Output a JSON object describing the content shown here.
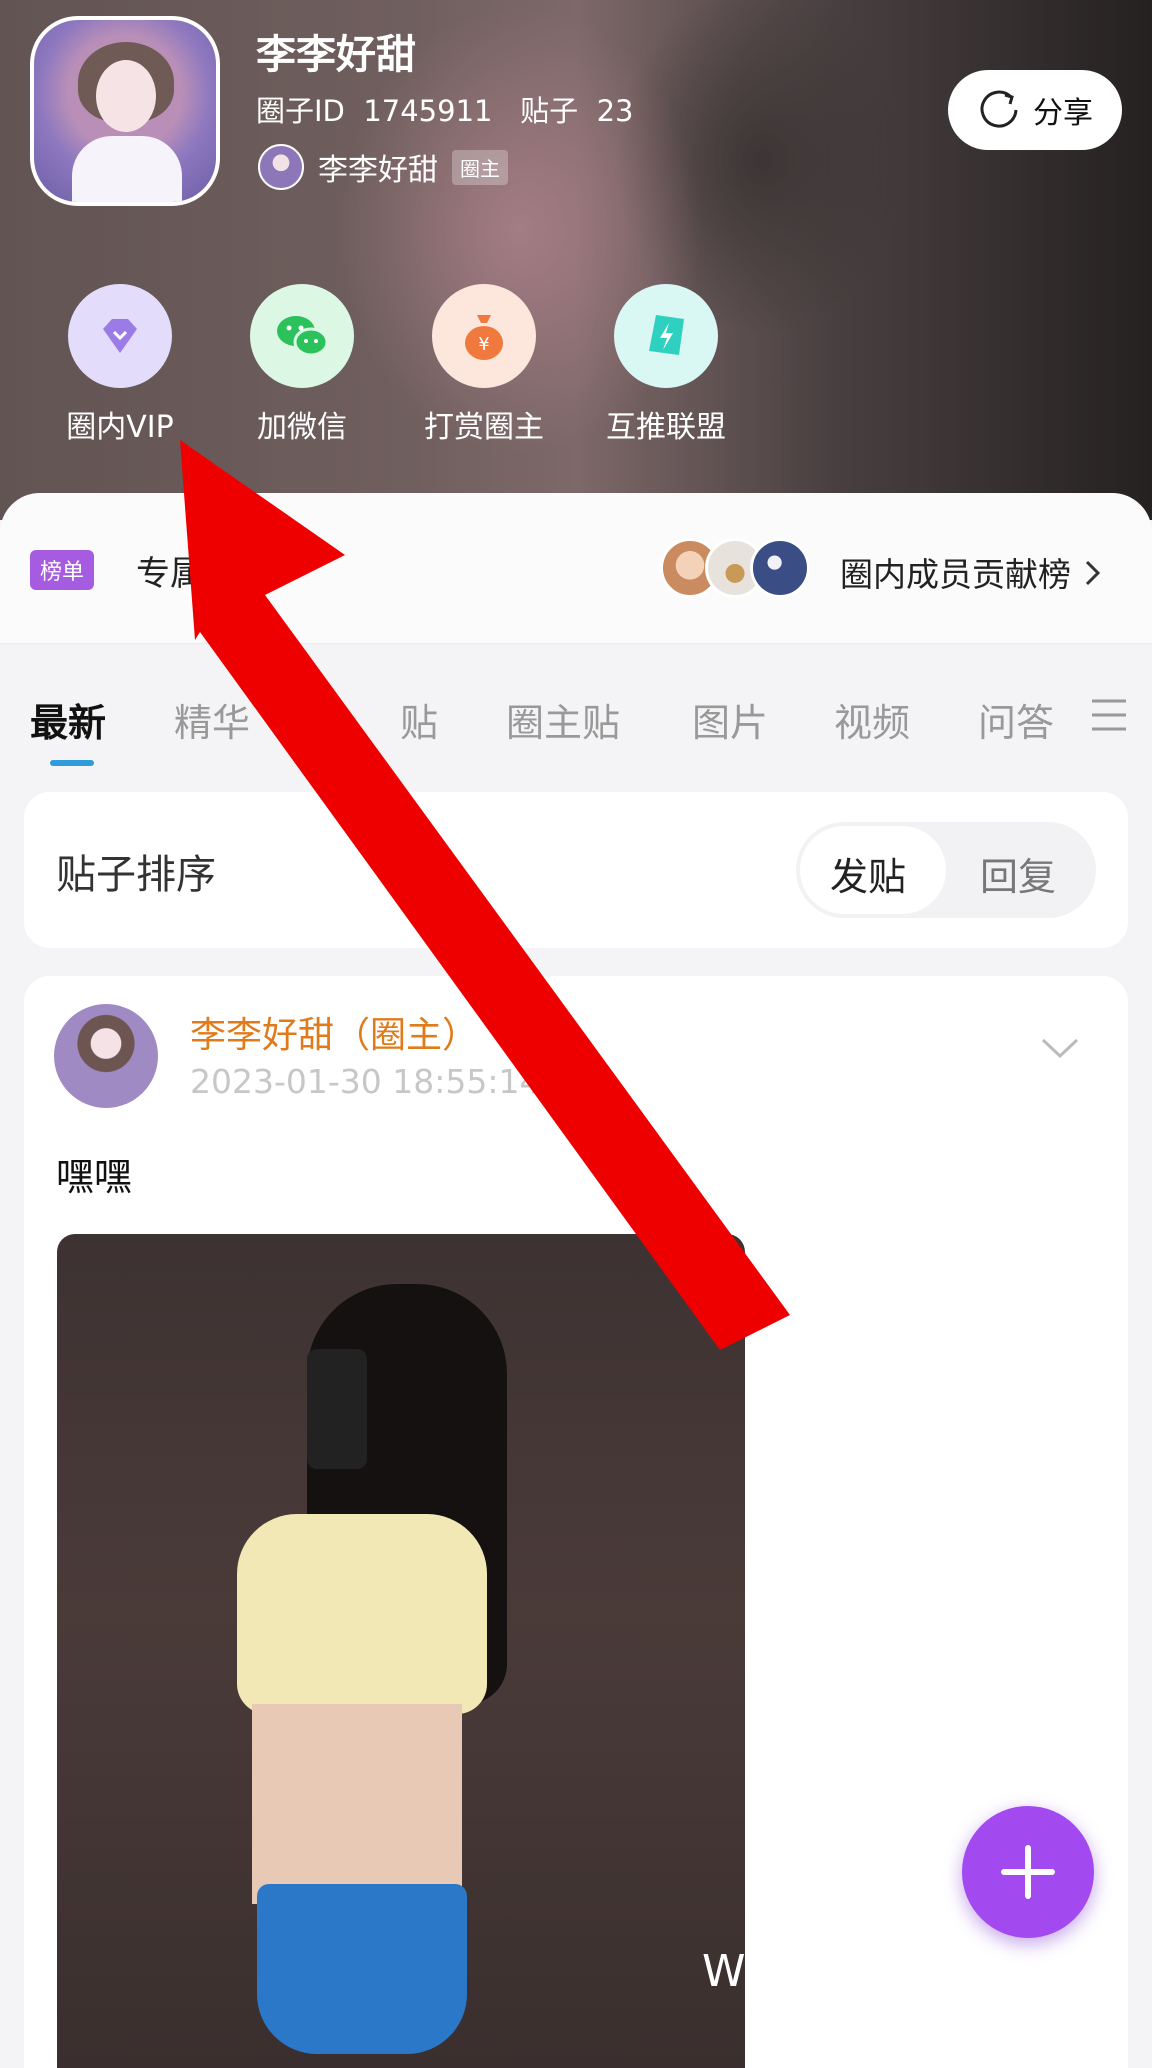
{
  "circle": {
    "name": "李李好甜",
    "meta": "圈子ID  1745911   贴子  23",
    "owner_name": "李李好甜",
    "owner_tag": "圈主"
  },
  "share": {
    "label": "分享",
    "icon": "refresh-icon"
  },
  "actions": [
    {
      "label": "圈内VIP",
      "icon": "diamond-icon",
      "bg": "#e4dcfb",
      "color": "#9b7be6"
    },
    {
      "label": "加微信",
      "icon": "wechat-icon",
      "bg": "#dcf8e5",
      "color": "#2bc25b"
    },
    {
      "label": "打赏圈主",
      "icon": "money-bag-icon",
      "bg": "#fde6dc",
      "color": "#f07a3e"
    },
    {
      "label": "互推联盟",
      "icon": "lightning-icon",
      "bg": "#d9f7f3",
      "color": "#2ed1c0"
    }
  ],
  "ranking": {
    "badge": "榜单",
    "title": "专属",
    "link": "圈内成员贡献榜"
  },
  "tabs": [
    {
      "label": "最新"
    },
    {
      "label": "精华"
    },
    {
      "label": "贴"
    },
    {
      "label": "圈主贴"
    },
    {
      "label": "图片"
    },
    {
      "label": "视频"
    },
    {
      "label": "问答"
    }
  ],
  "sort": {
    "label": "贴子排序",
    "options": [
      "发贴",
      "回复"
    ],
    "selected": "发贴"
  },
  "post": {
    "author": "李李好甜（圈主）",
    "time": "2023-01-30 18:55:14",
    "text": "嘿嘿",
    "watermark": "W"
  },
  "colors": {
    "accent": "#a349f0",
    "tab_indicator": "#2f9bd8",
    "author": "#e07b1c",
    "arrow": "#ef0000"
  }
}
